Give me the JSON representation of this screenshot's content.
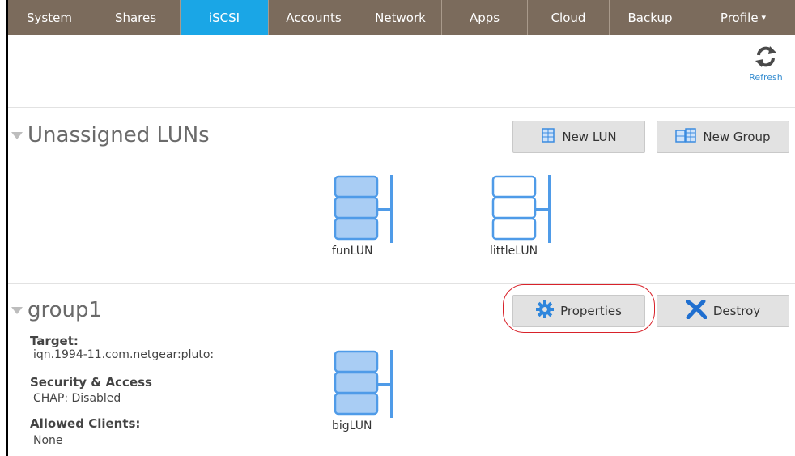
{
  "nav": {
    "items": [
      {
        "label": "System",
        "active": false
      },
      {
        "label": "Shares",
        "active": false
      },
      {
        "label": "iSCSI",
        "active": true
      },
      {
        "label": "Accounts",
        "active": false
      },
      {
        "label": "Network",
        "active": false
      },
      {
        "label": "Apps",
        "active": false
      },
      {
        "label": "Cloud",
        "active": false
      },
      {
        "label": "Backup",
        "active": false
      },
      {
        "label": "Profile",
        "active": false
      }
    ],
    "profile_caret": "▾"
  },
  "toolbar": {
    "refresh_label": "Refresh",
    "refresh_icon": "refresh-icon"
  },
  "unassigned": {
    "title": "Unassigned LUNs",
    "new_lun_label": "New LUN",
    "new_group_label": "New Group",
    "luns": [
      {
        "name": "funLUN",
        "filled": true
      },
      {
        "name": "littleLUN",
        "filled": false
      }
    ]
  },
  "group": {
    "title": "group1",
    "properties_label": "Properties",
    "destroy_label": "Destroy",
    "target_label": "Target:",
    "target_value": "iqn.1994-11.com.netgear:pluto:",
    "security_label": "Security & Access",
    "security_value": "CHAP: Disabled",
    "clients_label": "Allowed Clients:",
    "clients_value": "None",
    "luns": [
      {
        "name": "bigLUN",
        "filled": true
      }
    ]
  },
  "colors": {
    "nav_bg": "#7b6b5c",
    "nav_active": "#1aa6e6",
    "lun_blue": "#4f9be8",
    "lun_fill": "#a9cdf4",
    "highlight": "#d8222a"
  }
}
